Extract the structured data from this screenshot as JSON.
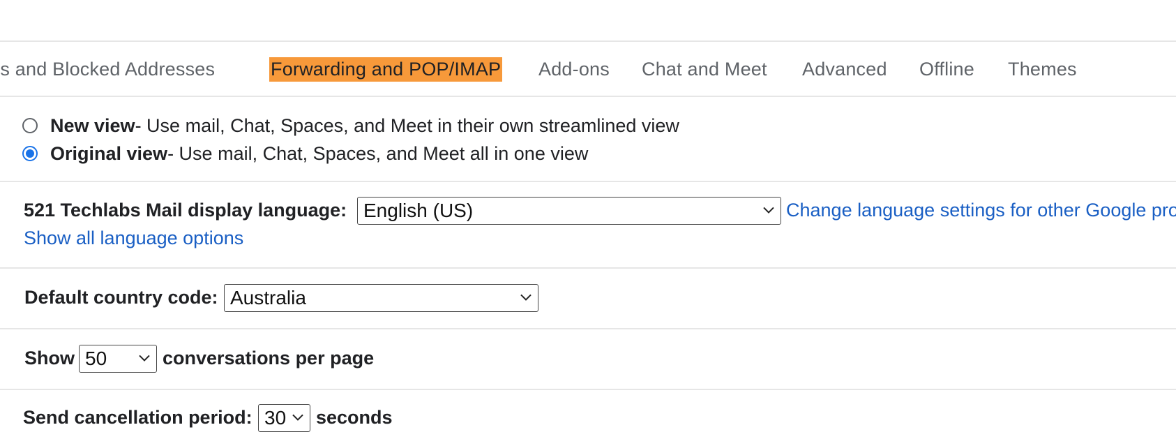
{
  "tabs": [
    {
      "label": "ers and Blocked Addresses",
      "active": false
    },
    {
      "label": "Forwarding and POP/IMAP",
      "active": true
    },
    {
      "label": "Add-ons",
      "active": false
    },
    {
      "label": "Chat and Meet",
      "active": false
    },
    {
      "label": "Advanced",
      "active": false
    },
    {
      "label": "Offline",
      "active": false
    },
    {
      "label": "Themes",
      "active": false
    }
  ],
  "view_options": [
    {
      "title": "New view",
      "description": " - Use mail, Chat, Spaces, and Meet in their own streamlined view",
      "selected": false
    },
    {
      "title": "Original view",
      "description": " - Use mail, Chat, Spaces, and Meet all in one view",
      "selected": true
    }
  ],
  "language": {
    "label": "521 Techlabs Mail display language:",
    "value": "English (US)",
    "change_link": "Change language settings for other Google products",
    "show_all_link": "Show all language options"
  },
  "country": {
    "label": "Default country code:",
    "value": "Australia"
  },
  "page_size": {
    "prefix": "Show",
    "value": "50",
    "suffix": "conversations per page"
  },
  "undo_send": {
    "label": "Send cancellation period:",
    "value": "30",
    "suffix": "seconds"
  },
  "colors": {
    "active_tab": "#f7993a",
    "link": "#1a5fc4",
    "radio_selected": "#1a73e8"
  }
}
